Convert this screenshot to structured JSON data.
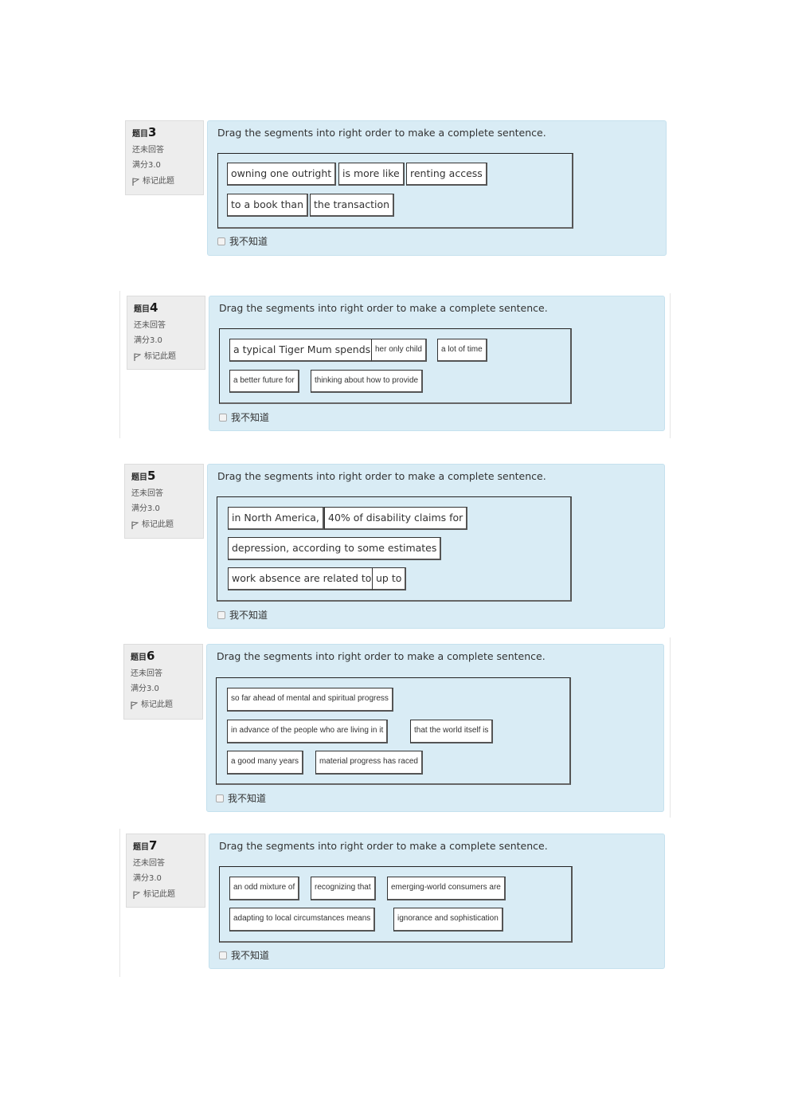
{
  "common": {
    "question_label": "题目",
    "state": "还未回答",
    "grade": "满分3.0",
    "flag_label": "标记此题",
    "prompt": "Drag the segments into right order to make a complete sentence.",
    "dont_know_label": "我不知道"
  },
  "questions": [
    {
      "number": "3",
      "segments": [
        "owning one outright",
        "is more like",
        "renting access",
        "to a book than",
        "the transaction"
      ]
    },
    {
      "number": "4",
      "segments": [
        "a typical Tiger Mum spends",
        "her only child",
        "a lot of time",
        "a better future for",
        "thinking about how to provide"
      ]
    },
    {
      "number": "5",
      "segments": [
        "in North America,",
        "40% of disability claims for",
        "depression, according to some estimates",
        "work absence are related to",
        "up to"
      ]
    },
    {
      "number": "6",
      "segments": [
        "so far ahead of mental and spiritual progress",
        "in advance of the people who are living in it",
        "that the world itself is",
        "a good many years",
        "material progress has raced"
      ]
    },
    {
      "number": "7",
      "segments": [
        "an odd mixture of",
        "recognizing that",
        "emerging-world consumers are",
        "adapting to local circumstances means",
        "ignorance and sophistication"
      ]
    }
  ]
}
